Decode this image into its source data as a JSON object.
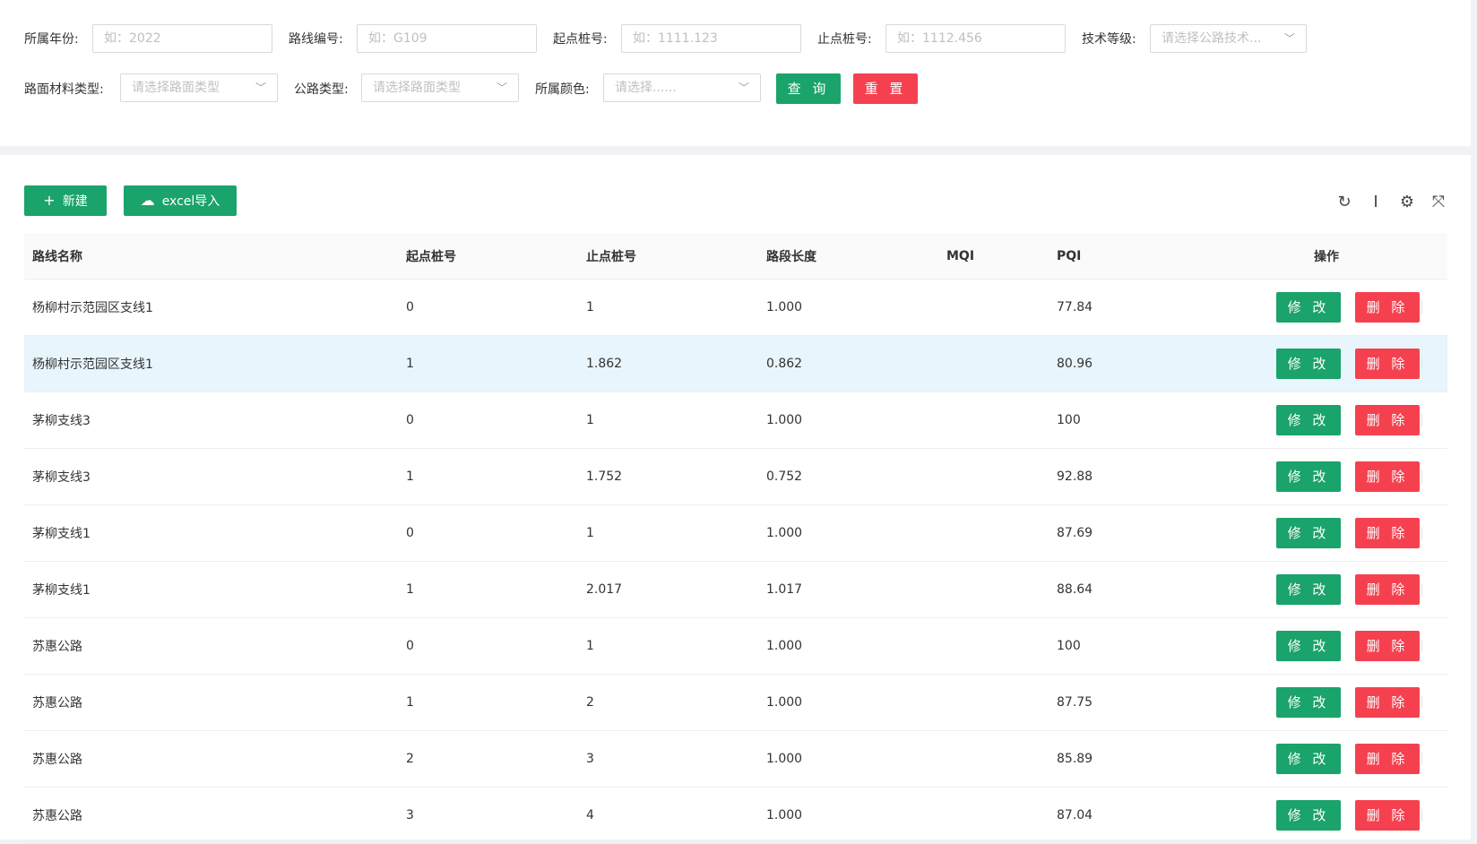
{
  "filters": {
    "year": {
      "label": "所属年份:",
      "placeholder": "如：2022"
    },
    "route_code": {
      "label": "路线编号:",
      "placeholder": "如：G109"
    },
    "start_stake": {
      "label": "起点桩号:",
      "placeholder": "如：1111.123"
    },
    "end_stake": {
      "label": "止点桩号:",
      "placeholder": "如：1112.456"
    },
    "tech_grade": {
      "label": "技术等级:",
      "placeholder": "请选择公路技术..."
    },
    "surface_type": {
      "label": "路面材料类型:",
      "placeholder": "请选择路面类型"
    },
    "road_type": {
      "label": "公路类型:",
      "placeholder": "请选择路面类型"
    },
    "color": {
      "label": "所属颜色:",
      "placeholder": "请选择......"
    },
    "query_label": "查 询",
    "reset_label": "重 置"
  },
  "toolbar": {
    "new_label": "新建",
    "import_label": "excel导入"
  },
  "table": {
    "columns": [
      "路线名称",
      "起点桩号",
      "止点桩号",
      "路段长度",
      "MQI",
      "PQI",
      "操作"
    ],
    "edit_label": "修 改",
    "delete_label": "删 除",
    "rows": [
      {
        "name": "杨柳村示范园区支线1",
        "start": "0",
        "end": "1",
        "length": "1.000",
        "mqi": "",
        "pqi": "77.84"
      },
      {
        "name": "杨柳村示范园区支线1",
        "start": "1",
        "end": "1.862",
        "length": "0.862",
        "mqi": "",
        "pqi": "80.96"
      },
      {
        "name": "茅柳支线3",
        "start": "0",
        "end": "1",
        "length": "1.000",
        "mqi": "",
        "pqi": "100"
      },
      {
        "name": "茅柳支线3",
        "start": "1",
        "end": "1.752",
        "length": "0.752",
        "mqi": "",
        "pqi": "92.88"
      },
      {
        "name": "茅柳支线1",
        "start": "0",
        "end": "1",
        "length": "1.000",
        "mqi": "",
        "pqi": "87.69"
      },
      {
        "name": "茅柳支线1",
        "start": "1",
        "end": "2.017",
        "length": "1.017",
        "mqi": "",
        "pqi": "88.64"
      },
      {
        "name": "苏惠公路",
        "start": "0",
        "end": "1",
        "length": "1.000",
        "mqi": "",
        "pqi": "100"
      },
      {
        "name": "苏惠公路",
        "start": "1",
        "end": "2",
        "length": "1.000",
        "mqi": "",
        "pqi": "87.75"
      },
      {
        "name": "苏惠公路",
        "start": "2",
        "end": "3",
        "length": "1.000",
        "mqi": "",
        "pqi": "85.89"
      },
      {
        "name": "苏惠公路",
        "start": "3",
        "end": "4",
        "length": "1.000",
        "mqi": "",
        "pqi": "87.04"
      }
    ]
  },
  "colors": {
    "primary": "#1aa36a",
    "danger": "#f5414f",
    "highlight": "#e8f5fd"
  }
}
